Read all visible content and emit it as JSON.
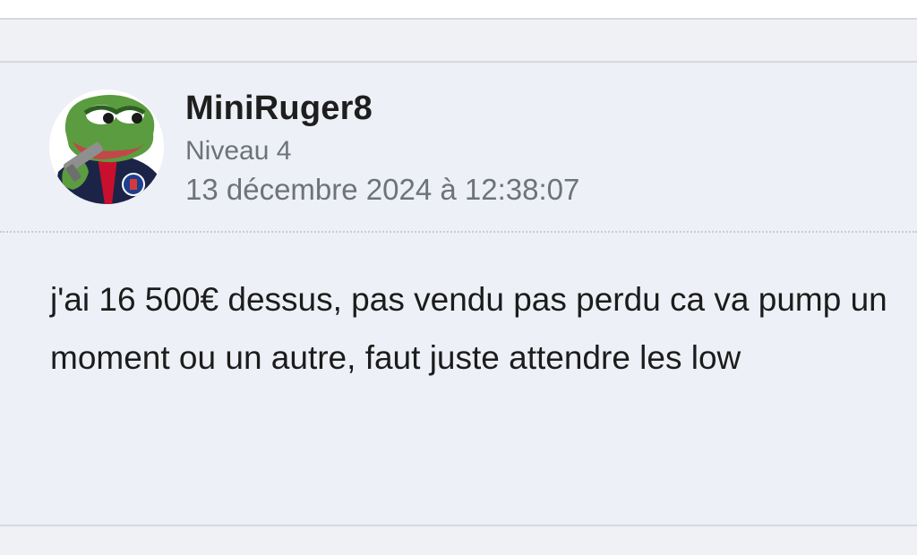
{
  "post": {
    "author": {
      "username": "MiniRuger8",
      "level": "Niveau 4",
      "avatar_icon": "frog-avatar-icon"
    },
    "date": "13 décembre 2024 à 12:38:07",
    "body": "j'ai 16 500€ dessus, pas vendu pas perdu ca va pump un moment ou un autre, faut juste attendre les low"
  },
  "colors": {
    "background": "#edf0f6",
    "meta_text": "#6d727c",
    "text": "#1c1c1c"
  }
}
